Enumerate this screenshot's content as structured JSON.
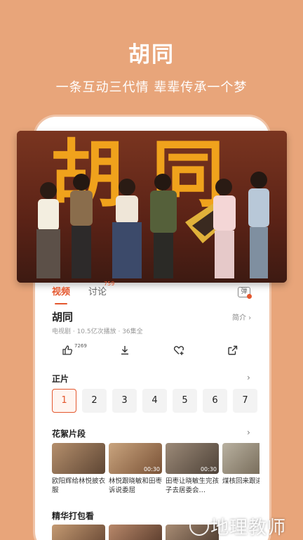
{
  "promo": {
    "title": "胡同",
    "subtitle": "一条互动三代情 辈辈传承一个梦"
  },
  "poster": {
    "title_art": "胡同"
  },
  "tabs": [
    {
      "label": "视频",
      "active": true
    },
    {
      "label": "讨论",
      "badge": "759"
    }
  ],
  "danmu_label": "弹",
  "show": {
    "title": "胡同",
    "intro_label": "简介 ›",
    "meta": "电视剧 · 10.5亿次播放 · 36集全",
    "like_count": "7269"
  },
  "icons": {
    "like": "thumbs-up-icon",
    "download": "download-icon",
    "favorite": "heart-plus-icon",
    "share": "share-icon"
  },
  "episodes_section": {
    "title": "正片",
    "arrow": "›",
    "items": [
      "1",
      "2",
      "3",
      "4",
      "5",
      "6",
      "7"
    ]
  },
  "clips_section": {
    "title": "花絮片段",
    "arrow": "›",
    "items": [
      {
        "title": "欧阳辉给林悦披衣服",
        "duration": ""
      },
      {
        "title": "林悦跟晓敏和田枣诉说委屈",
        "duration": "00:30"
      },
      {
        "title": "田枣让晓敏生完孩子去居委会…",
        "duration": "00:30"
      },
      {
        "title": "煤核回来跟道歉",
        "duration": ""
      }
    ]
  },
  "best_section": {
    "title": "精华打包看"
  },
  "watermark": "地理教师"
}
